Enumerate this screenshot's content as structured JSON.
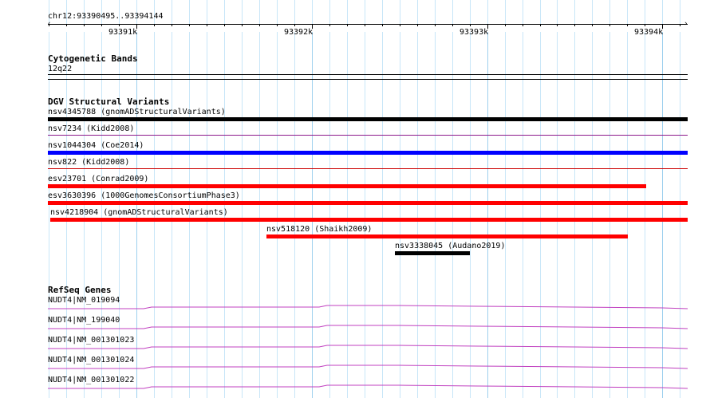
{
  "ruler": {
    "location": "chr12:93390495..93394144",
    "ticks": [
      {
        "label": "93391k",
        "pos": 93391000
      },
      {
        "label": "93392k",
        "pos": 93392000
      },
      {
        "label": "93393k",
        "pos": 93393000
      },
      {
        "label": "93394k",
        "pos": 93394000
      }
    ]
  },
  "cytoband": {
    "title": "Cytogenetic Bands",
    "band": "12q22"
  },
  "dgv": {
    "title": "DGV Structural Variants",
    "items": [
      {
        "label": "nsv4345788 (gnomADStructuralVariants)",
        "color": "#000000"
      },
      {
        "label": "nsv7234 (Kidd2008)",
        "color": "#8b1a8b"
      },
      {
        "label": "nsv1044304 (Coe2014)",
        "color": "#0000ff"
      },
      {
        "label": "nsv822 (Kidd2008)",
        "color": "#cc0000"
      },
      {
        "label": "esv23701 (Conrad2009)",
        "color": "#ff0000"
      },
      {
        "label": "esv3630396 (1000GenomesConsortiumPhase3)",
        "color": "#ff0000"
      },
      {
        "label": "nsv4218904 (gnomADStructuralVariants)",
        "color": "#ff0000"
      },
      {
        "label": "nsv518120 (Shaikh2009)",
        "color": "#ff0000"
      },
      {
        "label": "nsv3338045 (Audano2019)",
        "color": "#000000"
      }
    ]
  },
  "refseq": {
    "title": "RefSeq Genes",
    "color": "#c040c0",
    "genes": [
      {
        "label": "NUDT4|NM_019094"
      },
      {
        "label": "NUDT4|NM_199040"
      },
      {
        "label": "NUDT4|NM_001301023"
      },
      {
        "label": "NUDT4|NM_001301024"
      },
      {
        "label": "NUDT4|NM_001301022"
      }
    ]
  }
}
